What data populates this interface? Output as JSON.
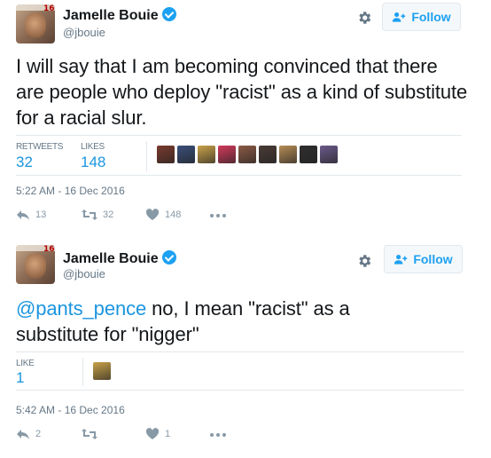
{
  "tweets": [
    {
      "name": "Jamelle Bouie",
      "handle": "@jbouie",
      "follow_label": "Follow",
      "text": "I will say that I am becoming convinced that there are people who deploy \"racist\" as a kind of substitute for a racial slur.",
      "stats": [
        {
          "label": "RETWEETS",
          "value": "32"
        },
        {
          "label": "LIKES",
          "value": "148"
        }
      ],
      "liker_avatars": [
        {
          "icon": "liker-avatar",
          "color": "#7a3b2e"
        },
        {
          "icon": "liker-avatar",
          "color": "#3a4f7a"
        },
        {
          "icon": "liker-avatar",
          "color": "#c9a24a"
        },
        {
          "icon": "liker-avatar",
          "color": "#d13a5a"
        },
        {
          "icon": "liker-avatar",
          "color": "#8c5a45"
        },
        {
          "icon": "liker-avatar",
          "color": "#4a3b35"
        },
        {
          "icon": "liker-avatar",
          "color": "#b58c55"
        },
        {
          "icon": "liker-avatar",
          "color": "#2f2f2f"
        },
        {
          "icon": "liker-avatar",
          "color": "#6b5a8a"
        }
      ],
      "timestamp": "5:22 AM - 16 Dec 2016",
      "actions": {
        "reply": "13",
        "retweet": "32",
        "like": "148"
      }
    },
    {
      "name": "Jamelle Bouie",
      "handle": "@jbouie",
      "follow_label": "Follow",
      "mention": "@pants_pence",
      "text": " no, I mean \"racist\" as a substitute for \"nigger\"",
      "stats": [
        {
          "label": "LIKE",
          "value": "1"
        }
      ],
      "liker_avatars": [
        {
          "icon": "liker-avatar",
          "color": "#c9a24a"
        }
      ],
      "timestamp": "5:42 AM - 16 Dec 2016",
      "actions": {
        "reply": "2",
        "retweet": "",
        "like": "1"
      }
    }
  ],
  "colors": {
    "accent": "#1da1f2",
    "link": "#1b95e0",
    "muted": "#657786",
    "border": "#e1e8ed"
  },
  "avatar_badge": "16"
}
